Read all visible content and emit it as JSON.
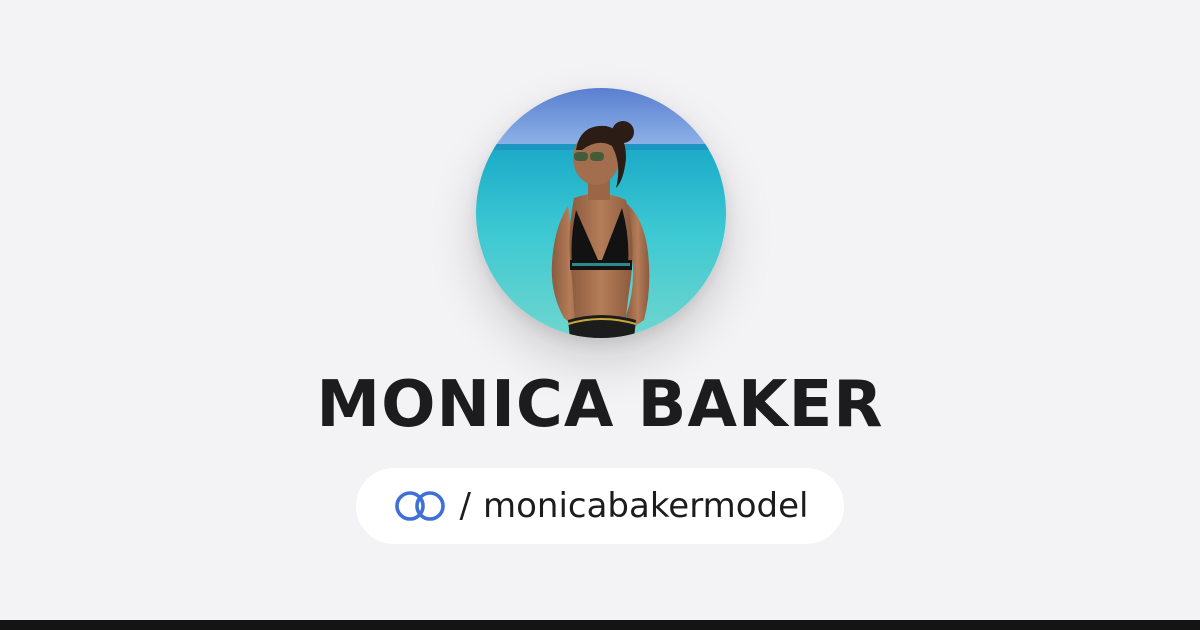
{
  "profile": {
    "name": "MONICA BAKER",
    "handle_separator": "/",
    "handle": "monicabakermodel"
  },
  "icons": {
    "avatar": "profile-photo",
    "logo": "linked-rings-icon"
  },
  "colors": {
    "background": "#f3f3f5",
    "text": "#1c1c1e",
    "pill_background": "#ffffff",
    "logo_blue": "#3f6fd8",
    "footer_bar": "#141414"
  }
}
